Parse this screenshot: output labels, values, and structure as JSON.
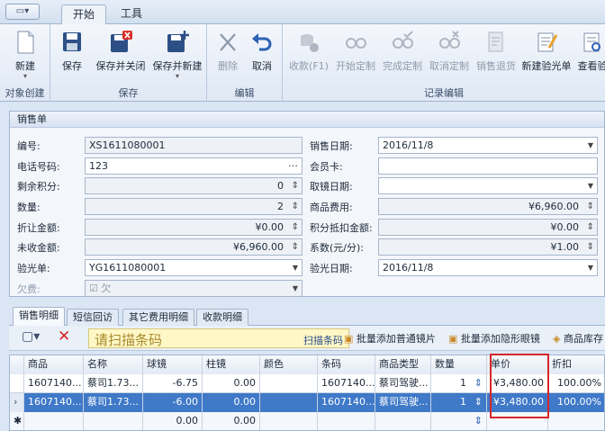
{
  "app_menu": {
    "icon": "window-icon"
  },
  "ribbon_tabs": [
    {
      "label": "开始"
    },
    {
      "label": "工具"
    }
  ],
  "ribbon": {
    "new_label": "新建",
    "save_label": "保存",
    "save_close_label": "保存并关闭",
    "save_new_label": "保存并新建",
    "delete_label": "删除",
    "cancel_label": "取消",
    "collect_label": "收款(F1)",
    "start_custom_label": "开始定制",
    "finish_custom_label": "完成定制",
    "cancel_custom_label": "取消定制",
    "return_label": "销售退货",
    "new_optometry_label": "新建验光单",
    "view_optometry_label": "查看验",
    "group_create": "对象创建",
    "group_save": "保存",
    "group_edit": "编辑",
    "group_record": "记录编辑"
  },
  "form": {
    "title": "销售单",
    "order_no_label": "编号:",
    "order_no": "XS1611080001",
    "phone_label": "电话号码:",
    "phone": "123",
    "points_left_label": "剩余积分:",
    "points_left": "0",
    "quantity_label": "数量:",
    "quantity": "2",
    "discount_amount_label": "折让金额:",
    "discount_amount": "¥0.00",
    "unpaid_label": "未收金额:",
    "unpaid": "¥6,960.00",
    "optometry_label": "验光单:",
    "optometry": "YG1611080001",
    "owed_label": "欠费:",
    "owed": "欠",
    "sale_date_label": "销售日期:",
    "sale_date": "2016/11/8",
    "member_card_label": "会员卡:",
    "member_card": "",
    "pickup_date_label": "取镜日期:",
    "pickup_date": "",
    "goods_fee_label": "商品费用:",
    "goods_fee": "¥6,960.00",
    "points_deduct_label": "积分抵扣金额:",
    "points_deduct": "¥0.00",
    "coefficient_label": "系数(元/分):",
    "coefficient": "¥1.00",
    "optometry_date_label": "验光日期:",
    "optometry_date": "2016/11/8"
  },
  "detail_tabs": [
    {
      "label": "销售明细"
    },
    {
      "label": "短信回访"
    },
    {
      "label": "其它费用明细"
    },
    {
      "label": "收款明细"
    }
  ],
  "detail_toolbar": {
    "scan_placeholder": "请扫描条码",
    "scan_button": "扫描条码",
    "batch_normal_label": "批量添加普通镜片",
    "batch_contact_label": "批量添加隐形眼镜",
    "stock_label": "商品库存"
  },
  "grid": {
    "columns": [
      "商品",
      "名称",
      "球镜",
      "柱镜",
      "颜色",
      "条码",
      "商品类型",
      "数量",
      "单价",
      "折扣"
    ],
    "rows": [
      {
        "product": "1607140...",
        "name": "蔡司1.73...",
        "sphere": "-6.75",
        "cylinder": "0.00",
        "color": "",
        "barcode": "1607140...",
        "type": "蔡司驾驶...",
        "qty": "1",
        "price": "¥3,480.00",
        "discount": "100.00%"
      },
      {
        "product": "1607140...",
        "name": "蔡司1.73...",
        "sphere": "-6.00",
        "cylinder": "0.00",
        "color": "",
        "barcode": "1607140...",
        "type": "蔡司驾驶...",
        "qty": "1",
        "price": "¥3,480.00",
        "discount": "100.00%"
      },
      {
        "product": "",
        "name": "",
        "sphere": "0.00",
        "cylinder": "0.00",
        "color": "",
        "barcode": "",
        "type": "",
        "qty": "",
        "price": "",
        "discount": ""
      }
    ]
  },
  "colors": {
    "highlight": "#d6262a",
    "selected_row": "#3f79c8"
  }
}
